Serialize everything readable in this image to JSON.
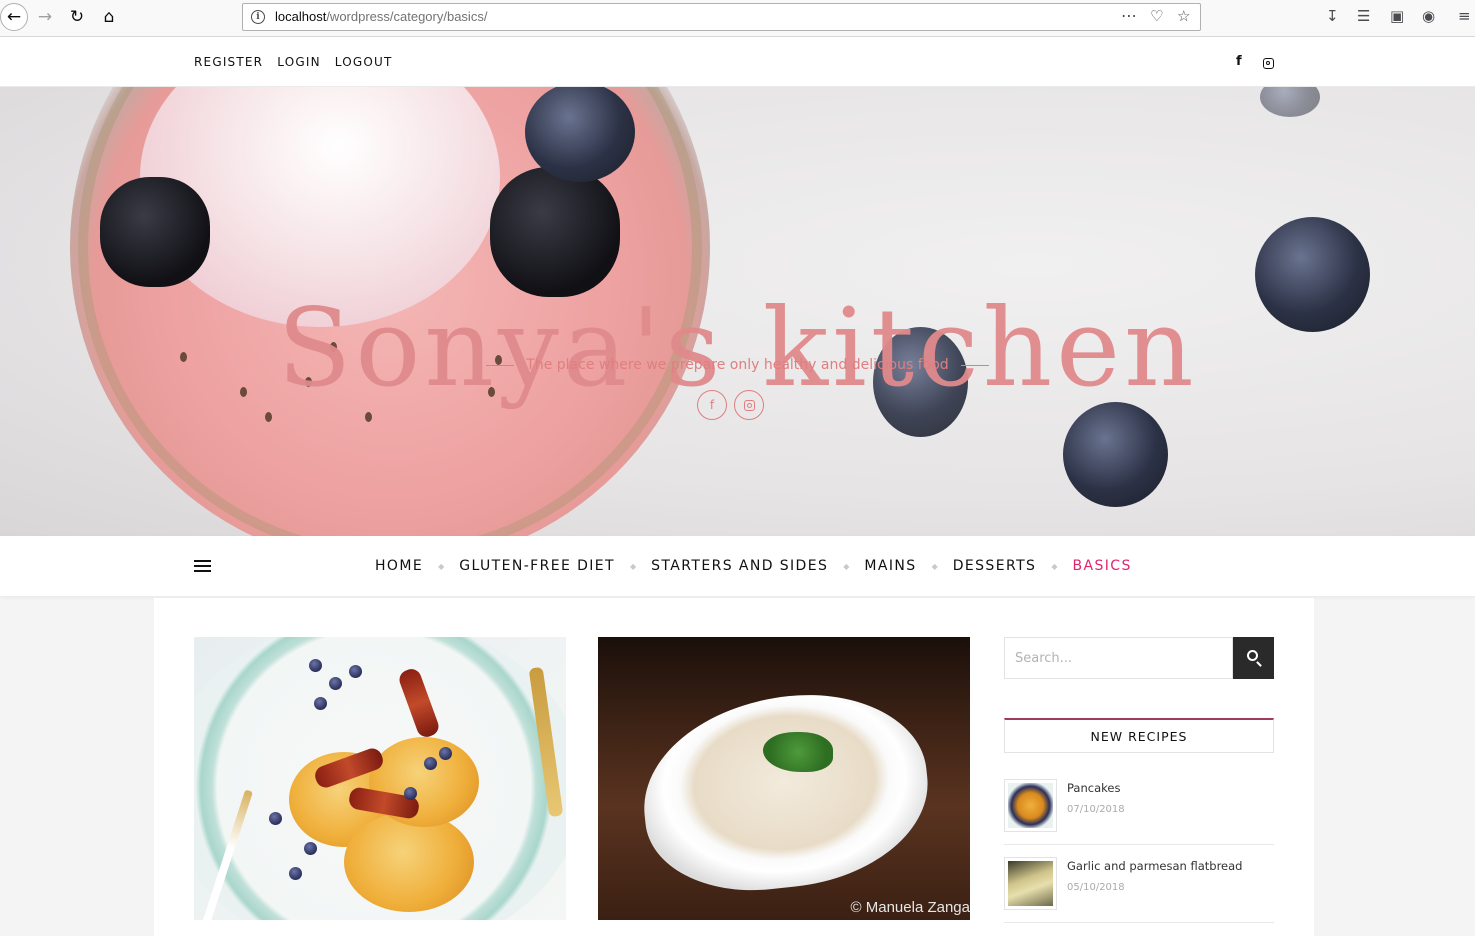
{
  "browser": {
    "url_host": "localhost",
    "url_path": "/wordpress/category/basics/"
  },
  "topbar": {
    "links": [
      "REGISTER",
      "LOGIN",
      "LOGOUT"
    ],
    "social": {
      "facebook": "f"
    }
  },
  "hero": {
    "title": "Sonya's kitchen",
    "tagline": "The place where we prepare only healthy and delicious food",
    "social": {
      "facebook": "f"
    }
  },
  "nav": {
    "items": [
      "HOME",
      "GLUTEN-FREE DIET",
      "STARTERS AND SIDES",
      "MAINS",
      "DESSERTS",
      "BASICS"
    ],
    "active": "BASICS",
    "active_color": "#e0256a"
  },
  "posts": [
    {
      "image": "pancakes-photo"
    },
    {
      "image": "hummus-photo",
      "credit": "© Manuela Zanga"
    }
  ],
  "sidebar": {
    "search_placeholder": "Search...",
    "widget_title": "NEW RECIPES",
    "recipes": [
      {
        "title": "Pancakes",
        "date": "07/10/2018"
      },
      {
        "title": "Garlic and parmesan flatbread",
        "date": "05/10/2018"
      }
    ]
  },
  "colors": {
    "accent": "#e0256a",
    "title_pink": "#e08a8c",
    "widget_border": "#a13a5c"
  }
}
